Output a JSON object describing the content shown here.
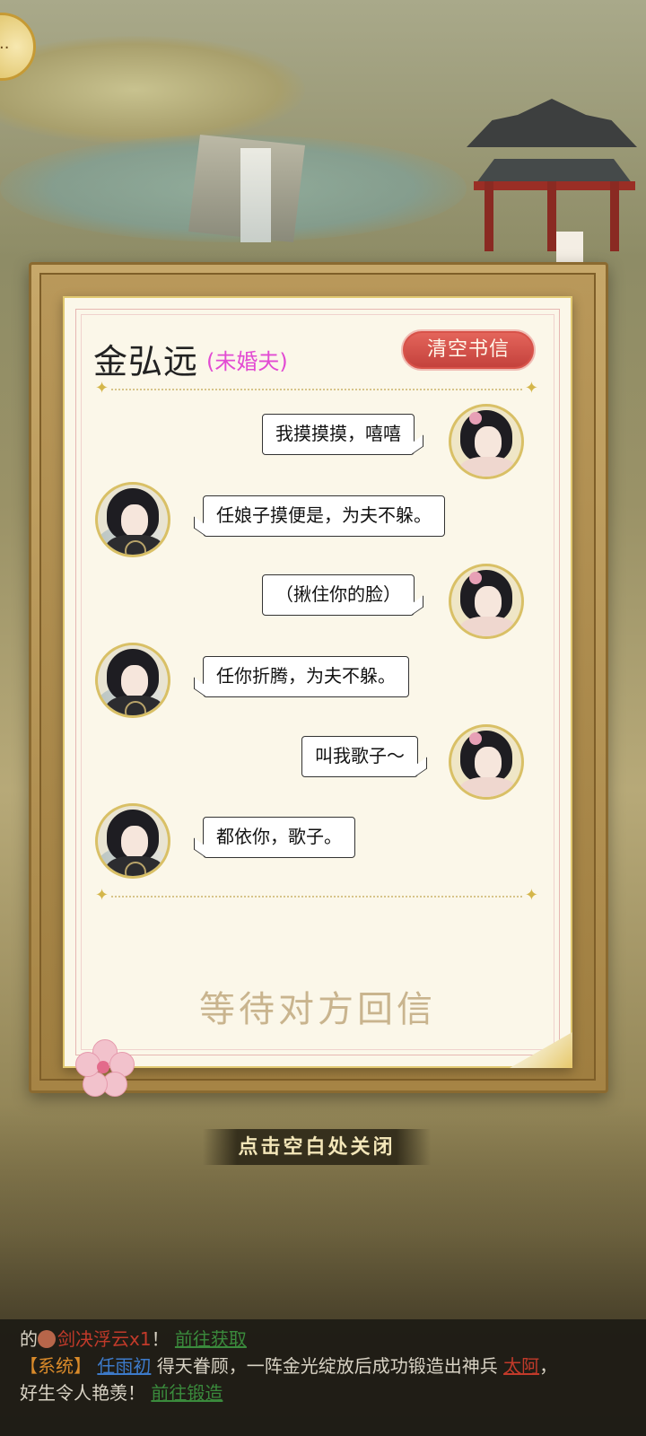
{
  "letter": {
    "name": "金弘远",
    "relation": "(未婚夫)",
    "clear_button": "清空书信",
    "waiting_text": "等待对方回信",
    "close_hint": "点击空白处关闭",
    "messages": [
      {
        "side": "right",
        "text": "我摸摸摸，嘻嘻"
      },
      {
        "side": "left",
        "text": "任娘子摸便是，为夫不躲。"
      },
      {
        "side": "right",
        "text": "（揪住你的脸）"
      },
      {
        "side": "left",
        "text": "任你折腾，为夫不躲。"
      },
      {
        "side": "right",
        "text": "叫我歌子～"
      },
      {
        "side": "left",
        "text": "都依你，歌子。"
      }
    ]
  },
  "ticker": {
    "line1_prefix": "的",
    "line1_item": "剑决浮云x1",
    "line1_mid": "！ ",
    "line1_link": "前往获取",
    "line2_tag": "【系统】",
    "line2_player": "任雨初",
    "line2_text": "得天眷顾，一阵金光绽放后成功锻造出神兵",
    "line2_weapon": "太阿",
    "line2_end": "，",
    "line3_text": "好生令人艳羡！",
    "line3_link": "前往锻造"
  },
  "colors": {
    "accent_red": "#c2403b",
    "relation_pink": "#e24bd3",
    "paper": "#fbf7e9",
    "link_green": "#3a8a3c",
    "link_blue": "#3d7ac9"
  },
  "icons": {
    "chat": "chat-bubble-icon",
    "divider": "sparkle-icon",
    "decor": "plum-blossom-icon"
  }
}
